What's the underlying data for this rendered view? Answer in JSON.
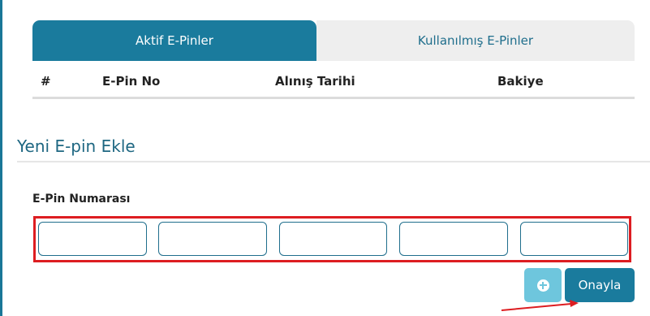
{
  "tabs": [
    {
      "label": "Aktif E-Pinler",
      "active": true
    },
    {
      "label": "Kullanılmış E-Pinler",
      "active": false
    }
  ],
  "table": {
    "headers": [
      "#",
      "E-Pin No",
      "Alınış Tarihi",
      "Bakiye"
    ]
  },
  "new_epin": {
    "title": "Yeni E-pin Ekle",
    "field_label": "E-Pin Numarası",
    "inputs": [
      "",
      "",
      "",
      "",
      ""
    ]
  },
  "buttons": {
    "add_icon": "plus-circle-icon",
    "confirm_label": "Onayla"
  },
  "colors": {
    "primary": "#1a7b9d",
    "add_button": "#6ec6dd",
    "highlight": "#dd1d21",
    "title": "#1e6782"
  }
}
